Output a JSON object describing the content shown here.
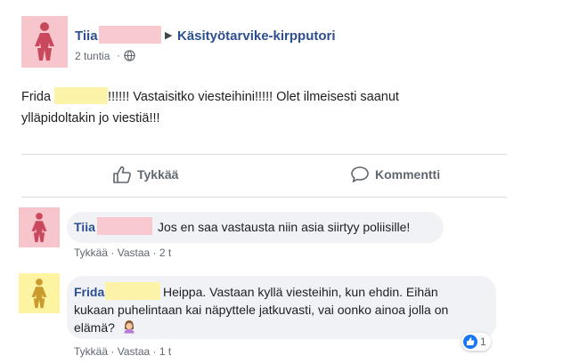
{
  "post": {
    "author": "Tiia",
    "group": "Käsityötarvike-kirpputori",
    "time": "2 tuntia",
    "text_line1_name": "Frida",
    "text_line1_rest": "!!!!!! Vastaisitko viesteihini!!!!! Olet ilmeisesti saanut",
    "text_line2": "ylläpidoltakin jo viestiä!!!"
  },
  "actions": {
    "like_label": "Tykkää",
    "comment_label": "Kommentti"
  },
  "comments": [
    {
      "author": "Tiia",
      "text": "Jos en saa vastausta niin asia siirtyy poliisille!",
      "like": "Tykkää",
      "reply": "Vastaa",
      "time": "2 t"
    },
    {
      "author": "Frida",
      "text_line1": "Heippa. Vastaan kyllä viesteihin, kun ehdin. Eihän",
      "text_line2": "kukaan puhelintaan kai näpyttele jatkuvasti, vai oonko ainoa jolla on",
      "text_line3": "elämä?",
      "like": "Tykkää",
      "reply": "Vastaa",
      "time": "1 t",
      "reaction_count": "1"
    }
  ],
  "colors": {
    "pink_avatar": "#f7c6cd",
    "pink_figure": "#c9485b",
    "yellow_avatar": "#fdf3a0",
    "yellow_figure": "#c99a2e",
    "link": "#2d4f8f",
    "like_blue": "#1877f2"
  }
}
